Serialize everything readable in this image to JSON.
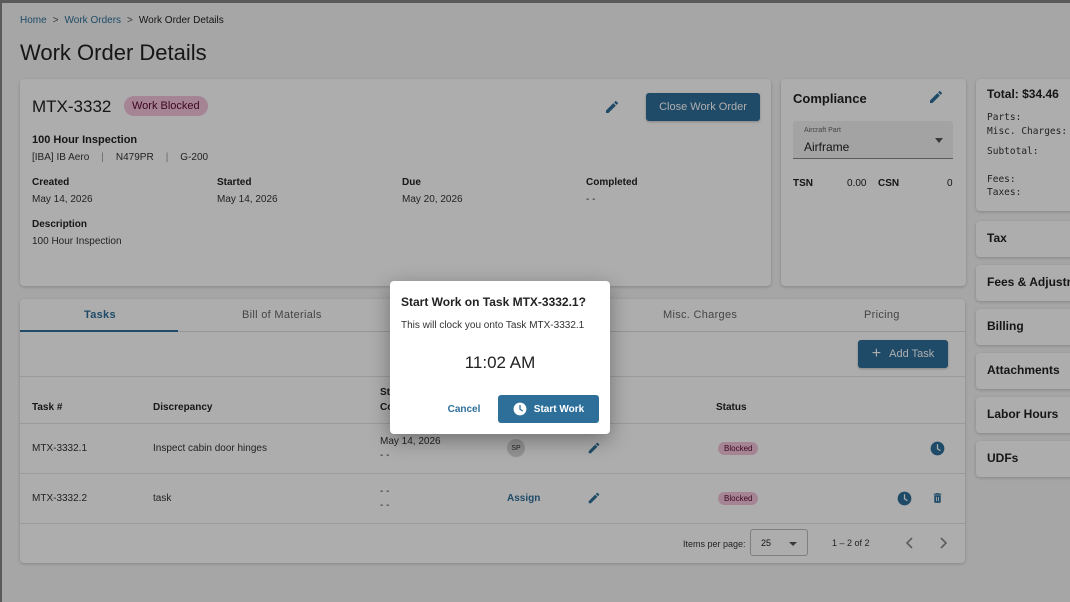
{
  "breadcrumb": {
    "home": "Home",
    "work_orders": "Work Orders",
    "current": "Work Order Details",
    "separator": ">"
  },
  "page_title": "Work Order Details",
  "work_order": {
    "number": "MTX-3332",
    "status_badge": "Work Blocked",
    "close_button": "Close Work Order",
    "title": "100 Hour Inspection",
    "customer": "[IBA] IB Aero",
    "tail": "N479PR",
    "model": "G-200",
    "created_label": "Created",
    "created": "May 14, 2026",
    "started_label": "Started",
    "started": "May 14, 2026",
    "due_label": "Due",
    "due": "May 20, 2026",
    "completed_label": "Completed",
    "completed": "- -",
    "description_label": "Description",
    "description": "100 Hour Inspection"
  },
  "compliance": {
    "title": "Compliance",
    "aircraft_part_label": "Aircraft Part",
    "aircraft_part_value": "Airframe",
    "tsn_label": "TSN",
    "tsn": "0.00",
    "csn_label": "CSN",
    "csn": "0"
  },
  "totals": {
    "title": "Total: $34.46",
    "parts": "Parts:",
    "misc": "Misc. Charges:",
    "subtotal": "Subtotal:",
    "fees": "Fees:",
    "taxes": "Taxes:"
  },
  "side_sections": [
    "Tax",
    "Fees & Adjustm",
    "Billing",
    "Attachments",
    "Labor Hours",
    "UDFs"
  ],
  "tabs": [
    "Tasks",
    "Bill of Materials",
    "Misc. Charges",
    "Pricing"
  ],
  "add_task_button": "Add Task",
  "table": {
    "headers": {
      "task": "Task #",
      "discrepancy": "Discrepancy",
      "st_top": "St",
      "st_bottom": "Co",
      "status": "Status"
    },
    "rows": [
      {
        "task": "MTX-3332.1",
        "discrepancy": "Inspect cabin door hinges",
        "date1": "May 14, 2026",
        "date2": "- -",
        "assignee": "SP",
        "status": "Blocked"
      },
      {
        "task": "MTX-3332.2",
        "discrepancy": "task",
        "date1": "- -",
        "date2": "- -",
        "assignee": "Assign",
        "status": "Blocked"
      }
    ]
  },
  "pagination": {
    "items_label": "Items per page:",
    "per_page": "25",
    "range": "1 – 2 of 2"
  },
  "dialog": {
    "title": "Start Work on Task MTX-3332.1?",
    "body": "This will clock you onto Task MTX-3332.1",
    "time": "11:02 AM",
    "cancel": "Cancel",
    "start": "Start Work"
  },
  "colors": {
    "primary": "#2e6f9a",
    "blocked_bg": "#f3c3da",
    "blocked_text": "#5a0a32"
  },
  "icons": [
    "pencil-icon",
    "clock-icon",
    "trash-icon",
    "plus-icon",
    "chevron-left-icon",
    "chevron-right-icon",
    "dropdown-caret-icon"
  ]
}
